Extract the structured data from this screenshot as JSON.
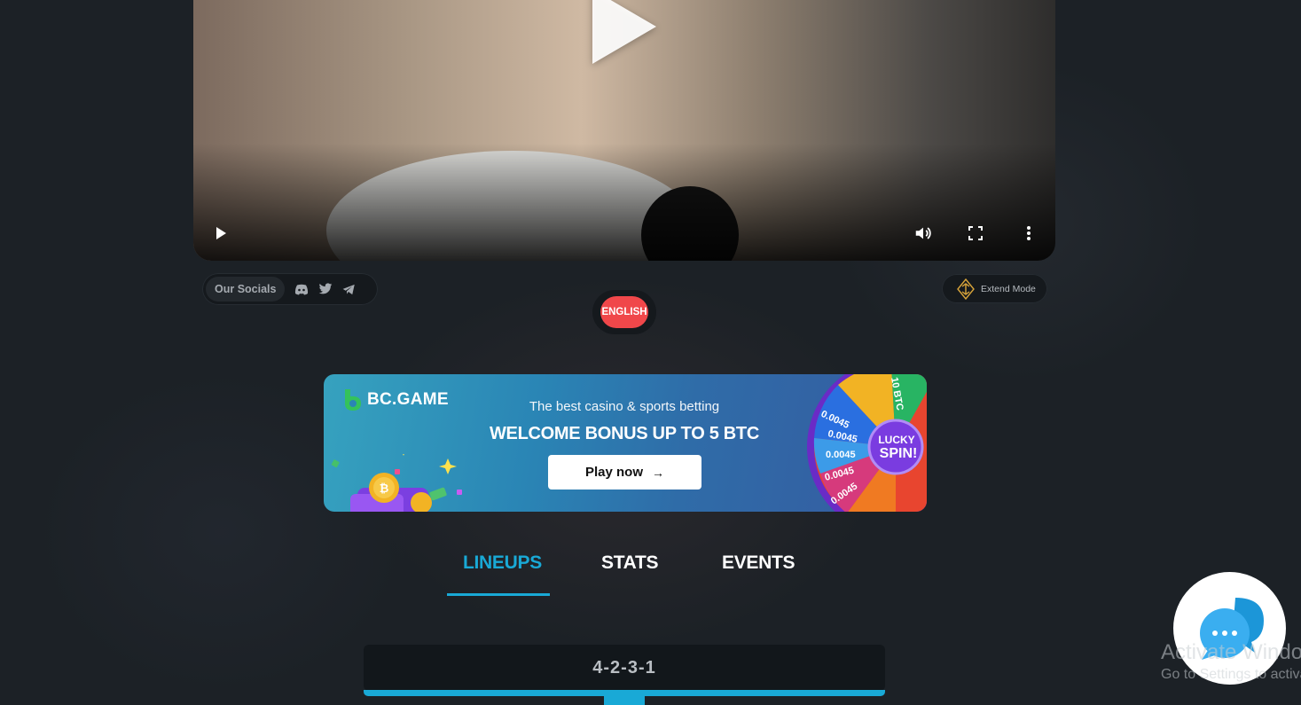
{
  "video": {
    "controls": [
      "play-icon",
      "volume-icon",
      "fullscreen-icon",
      "more-vert-icon"
    ]
  },
  "socials": {
    "label": "Our Socials",
    "icons": [
      "discord-icon",
      "twitter-icon",
      "telegram-icon"
    ]
  },
  "extend_mode": {
    "label": "Extend Mode"
  },
  "language": {
    "label": "ENGLISH"
  },
  "banner": {
    "brand": "BC.GAME",
    "tagline": "The best casino & sports betting",
    "headline": "WELCOME BONUS UP TO 5 BTC",
    "cta": "Play now",
    "wheel_label": "LUCKY SPIN!",
    "wheel_values": [
      "0.0045",
      "0.0045",
      "0.0045",
      "0.0045",
      "0.0045",
      "10 BTC"
    ]
  },
  "tabs": [
    {
      "label": "LINEUPS",
      "active": true
    },
    {
      "label": "STATS",
      "active": false
    },
    {
      "label": "EVENTS",
      "active": false
    }
  ],
  "formation": {
    "label": "4-2-3-1"
  },
  "watermark": {
    "title": "Activate Windows",
    "subtitle": "Go to Settings to activate Windows."
  },
  "colors": {
    "accent": "#19a9d6",
    "lang_button": "#f0474a",
    "background": "#1c2126"
  }
}
